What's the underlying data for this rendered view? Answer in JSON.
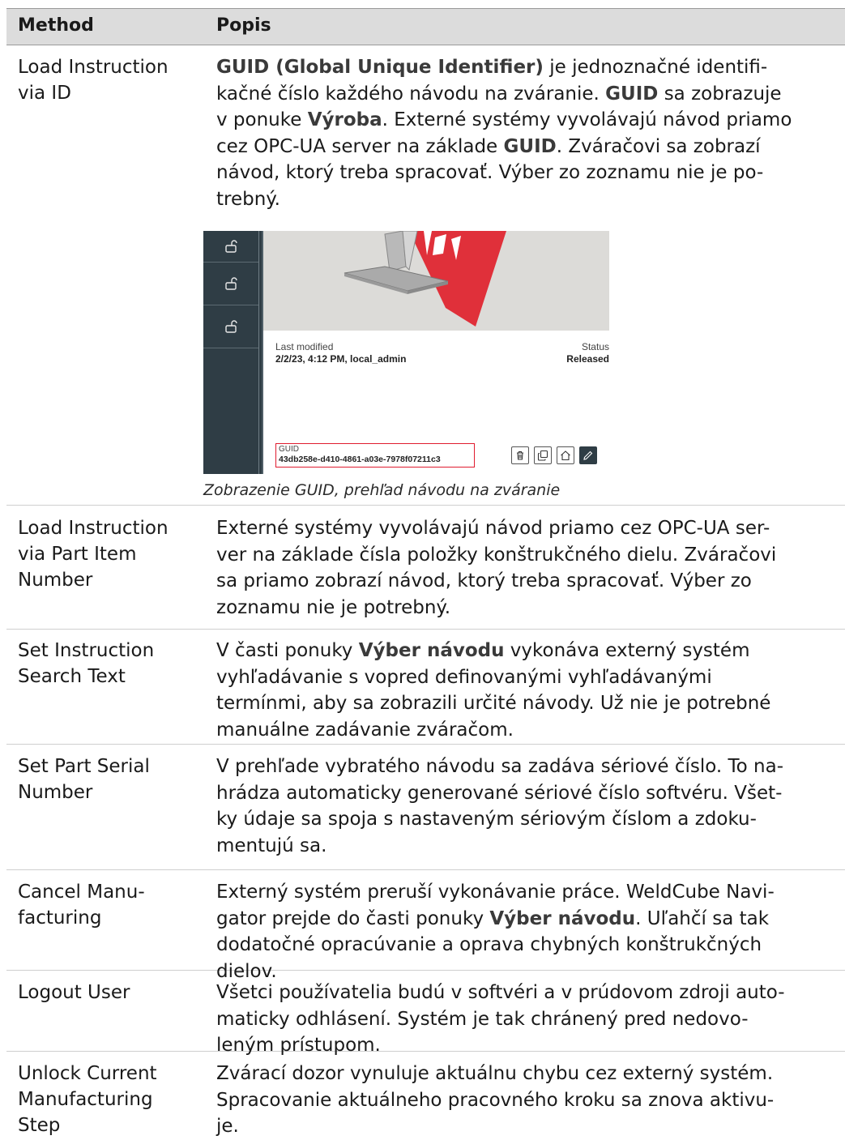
{
  "header": {
    "method": "Method",
    "popis": "Popis"
  },
  "rows": [
    {
      "method": [
        "Load Instruction",
        "via ID"
      ]
    },
    {
      "method": [
        "Load Instruction",
        "via Part Item",
        "Number"
      ],
      "desc": "Externé systémy vyvolávajú návod priamo cez OPC-UA ser-\nver na základe čísla položky konštrukčného dielu. Zváračovi\nsa priamo zobrazí návod, ktorý treba spracovať. Výber zo\nzoznamu nie je potrebný."
    },
    {
      "method": [
        "Set Instruction",
        "Search Text"
      ]
    },
    {
      "method": [
        "Set Part Serial",
        "Number"
      ],
      "desc": "V prehľade vybratého návodu sa zadáva sériové číslo. To na-\nhrádza automaticky generované sériové číslo softvéru. Všet-\nky údaje sa spoja s nastaveným sériovým číslom a zdoku-\nmentujú sa."
    },
    {
      "method": [
        "Cancel Manu-",
        "facturing"
      ]
    },
    {
      "method": [
        "Logout User"
      ],
      "desc": "Všetci používatelia budú v softvéri a v prúdovom zdroji auto-\nmaticky odhlásení. Systém je tak chránený pred nedovo-\nleným prístupom."
    },
    {
      "method": [
        "Unlock Current",
        "Manufacturing",
        "Step"
      ],
      "desc": "Zvárací dozor vynuluje aktuálnu chybu cez externý systém.\nSpracovanie aktuálneho pracovného kroku sa znova aktivu-\nje."
    }
  ],
  "row0_desc": {
    "p1_bold": "GUID (Global Unique Identifier)",
    "p1_rest": " je jednoznačné identifi-",
    "l2": "kačné číslo každého návodu na zváranie. ",
    "l2_bold": "GUID",
    "l2_rest": " sa zobrazuje",
    "l3": "v ponuke ",
    "l3_bold": "Výroba",
    "l3_rest": ". Externé systémy vyvolávajú návod priamo",
    "l4": "cez OPC-UA server na základe ",
    "l4_bold": "GUID",
    "l4_rest": ". Zváračovi sa zobrazí",
    "l5": "návod, ktorý treba spracovať. Výber zo zoznamu nie je po-",
    "l6": "trebný."
  },
  "row2_desc": {
    "l1": "V časti ponuky ",
    "l1_bold": "Výber návodu",
    "l1_rest": " vykonáva externý systém",
    "l2": "vyhľadávanie s vopred definovanými vyhľadávanými",
    "l3": "termínmi, aby sa zobrazili určité návody. Už nie je potrebné",
    "l4": "manuálne zadávanie zváračom."
  },
  "row4_desc": {
    "l1": "Externý systém preruší vykonávanie práce. WeldCube Navi-",
    "l2": "gator prejde do časti ponuky ",
    "l2_bold": "Výber návodu",
    "l2_rest": ". Uľahčí sa tak",
    "l3": "dodatočné opracúvanie a oprava chybných konštrukčných",
    "l4": "dielov."
  },
  "screenshot": {
    "last_modified_label": "Last modified",
    "last_modified_value": "2/2/23, 4:12 PM, local_admin",
    "status_label": "Status",
    "status_value": "Released",
    "guid_label": "GUID",
    "guid_value": "43db258e-d410-4861-a03e-7978f07211c3",
    "icons": [
      "unlock-icon",
      "unlock-icon",
      "unlock-icon",
      "trash-icon",
      "copy-icon",
      "home-icon",
      "pencil-icon"
    ]
  },
  "caption": "Zobrazenie GUID, prehľad návodu na zváranie",
  "colors": {
    "header_bg": "#dcdcdc",
    "highlight": "#e01b2f",
    "sidebar": "#2f3d45",
    "part_red": "#e0303a"
  }
}
